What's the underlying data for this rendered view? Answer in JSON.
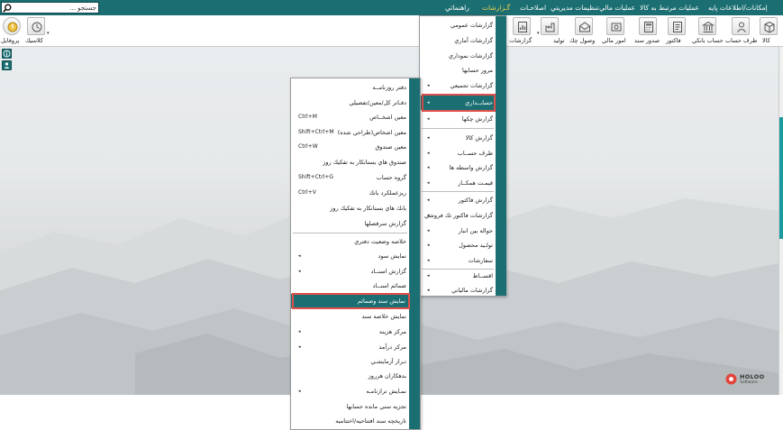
{
  "menubar": {
    "items": [
      {
        "label": "إمكانات/اطلاعات پايه",
        "active": false
      },
      {
        "label": "عمليات مرتبط به كالا",
        "active": false
      },
      {
        "label": "عمليات مالي",
        "active": false
      },
      {
        "label": "تنظيمات مديريتي",
        "active": false
      },
      {
        "label": "اصلاحـات",
        "active": false
      },
      {
        "label": "گـزارشات",
        "active": true
      },
      {
        "label": "راهنمائي",
        "active": false
      }
    ],
    "search_placeholder": "جستجو ..."
  },
  "toolbar": {
    "buttons": [
      {
        "label": "كالا",
        "icon": "box-icon"
      },
      {
        "label": "طرف حساب",
        "icon": "person-icon"
      },
      {
        "label": "حساب بانكي",
        "icon": "bank-icon"
      },
      {
        "label": "فاكتور",
        "icon": "invoice-icon"
      },
      {
        "label": "صدور سند",
        "icon": "calculator-icon"
      },
      {
        "label": "امور مالي",
        "icon": "finance-icon"
      },
      {
        "label": "وصول چك",
        "icon": "cheque-icon"
      },
      {
        "label": "توليد",
        "icon": "production-icon"
      },
      {
        "label": "گزارشات",
        "icon": "report-icon"
      },
      {
        "label": "كلاسيك",
        "icon": "classic-icon"
      },
      {
        "label": "پروفايل",
        "icon": "profile-icon"
      }
    ]
  },
  "reports_menu": {
    "items": [
      {
        "label": "گزارشات عمومي",
        "arrow": false
      },
      {
        "label": "گزارشات آماري",
        "arrow": false
      },
      {
        "label": "گزارشات نموداري",
        "arrow": false
      },
      {
        "label": "مرور حسابها",
        "arrow": false
      },
      {
        "label": "گزارشات تجميعي",
        "arrow": true
      },
      {
        "label": "حسابــداري",
        "arrow": true,
        "highlighted": true
      },
      {
        "label": "گزارش چكها",
        "arrow": true
      },
      {
        "label": "گزارش كالا",
        "arrow": true
      },
      {
        "label": "طرف حســاب",
        "arrow": true
      },
      {
        "label": "گزارش واسطه ها",
        "arrow": true
      },
      {
        "label": "قيمـت همكــار",
        "arrow": true
      },
      {
        "label": "گزارش فاكتور",
        "arrow": true
      },
      {
        "label": "گزارشات فاكتور تك فروشي",
        "arrow": true
      },
      {
        "label": "حواله بين انبار",
        "arrow": true
      },
      {
        "label": "تولـيد محصول",
        "arrow": true
      },
      {
        "label": "سفارشات",
        "arrow": true
      },
      {
        "label": "اقســاط",
        "arrow": true
      },
      {
        "label": "گزارشات مالياتي",
        "arrow": true
      }
    ]
  },
  "accounting_menu": {
    "items": [
      {
        "label": "دفتر روزنامــه",
        "arrow": false,
        "shortcut": ""
      },
      {
        "label": "دفـاتر كل/معين/تفصيلي",
        "arrow": false,
        "shortcut": ""
      },
      {
        "label": "معين اشخــاص",
        "arrow": false,
        "shortcut": "Ctrl+M"
      },
      {
        "label": "معين اشخاص(طراحي شده)",
        "arrow": false,
        "shortcut": "Shift+Ctrl+M"
      },
      {
        "label": "معين صندوق",
        "arrow": false,
        "shortcut": "Ctrl+W"
      },
      {
        "label": "صندوق هاي بستانكار به تفكيك روز",
        "arrow": false,
        "shortcut": ""
      },
      {
        "label": "گروه حساب",
        "arrow": false,
        "shortcut": "Shift+Ctrl+G"
      },
      {
        "label": "ريزعملكرد بانك",
        "arrow": false,
        "shortcut": "Ctrl+V"
      },
      {
        "label": "بانك هاي بستانكار به تفكيك روز",
        "arrow": false,
        "shortcut": ""
      },
      {
        "label": "گزارش سرفصلها",
        "arrow": false,
        "shortcut": ""
      },
      {
        "label": "خلاصه وضعيت دفتري",
        "arrow": false,
        "shortcut": ""
      },
      {
        "label": "نمايش سود",
        "arrow": true,
        "shortcut": ""
      },
      {
        "label": "گزارش اسنــاد",
        "arrow": true,
        "shortcut": ""
      },
      {
        "label": "ضمائم اسنــاد",
        "arrow": false,
        "shortcut": ""
      },
      {
        "label": "نمايش سند وضمائم",
        "arrow": false,
        "shortcut": "",
        "highlighted": true
      },
      {
        "label": "نمايش خلاصه سند",
        "arrow": false,
        "shortcut": ""
      },
      {
        "label": "مركز هزينه",
        "arrow": true,
        "shortcut": ""
      },
      {
        "label": "مركز درآمد",
        "arrow": true,
        "shortcut": ""
      },
      {
        "label": "تـراز آزمايشـي",
        "arrow": false,
        "shortcut": ""
      },
      {
        "label": "بدهكاران هرروز",
        "arrow": false,
        "shortcut": ""
      },
      {
        "label": "نمـايش ترازنامـه",
        "arrow": true,
        "shortcut": ""
      },
      {
        "label": "تجزيه سني مانده حسابها",
        "arrow": false,
        "shortcut": ""
      },
      {
        "label": "تاريخچه سند افتتاحيه/اختتاميه",
        "arrow": false,
        "shortcut": ""
      }
    ]
  },
  "logo": {
    "name": "HOLOO",
    "sub": "Software"
  },
  "colors": {
    "teal": "#1b6f73",
    "highlight_border": "#e0504a",
    "active_menu": "#f6d14b"
  }
}
